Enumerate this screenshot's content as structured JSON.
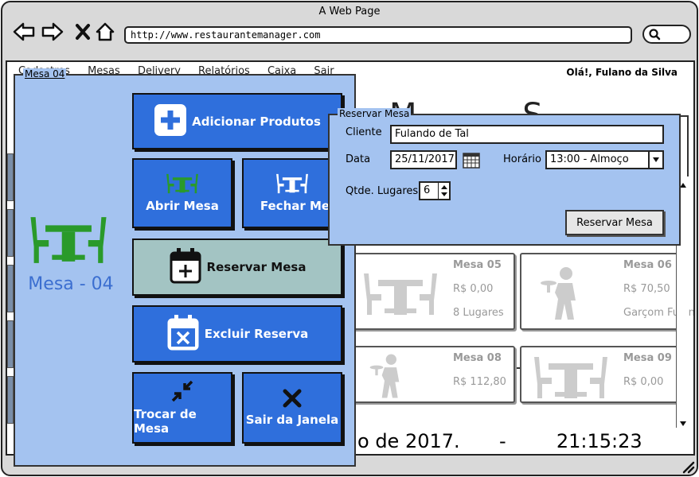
{
  "window": {
    "title": "A Web Page"
  },
  "browser": {
    "url": "http://www.restaurantemanager.com",
    "icons": [
      "back-arrow-icon",
      "forward-arrow-icon",
      "close-x-icon",
      "home-icon",
      "search-icon"
    ]
  },
  "app": {
    "menu": [
      "Cadastros",
      "Mesas",
      "Delivery",
      "Relatórios",
      "Caixa",
      "Sair"
    ],
    "greeting": "Olá!, Fulano da Silva",
    "bg_title": "M     S",
    "clock": {
      "date_fragment": "o de 2017.",
      "separator": "-",
      "time": "21:15:23"
    }
  },
  "tables": [
    {
      "name": "Mesa 05",
      "value": "R$ 0,00",
      "detail": "8 Lugares",
      "icon": "table-icon"
    },
    {
      "name": "Mesa 06",
      "value": "R$ 70,50",
      "detail": "Garçom Fulano",
      "icon": "waiter-icon"
    },
    {
      "name": "Mesa 08",
      "value": "R$ 112,80",
      "detail": "",
      "icon": "waiter-icon"
    },
    {
      "name": "Mesa 09",
      "value": "R$ 0,00",
      "detail": "",
      "icon": "table-icon"
    }
  ],
  "mesa_dialog": {
    "title": "Mesa 04",
    "table_label": "Mesa - 04",
    "buttons": {
      "add_products": "Adicionar Produtos",
      "open_table": "Abrir Mesa",
      "close_table": "Fechar Mesa",
      "reserve_table": "Reservar Mesa",
      "delete_reservation": "Excluir Reserva",
      "change_table": "Trocar de Mesa",
      "exit_window": "Sair da Janela"
    }
  },
  "reserva_dialog": {
    "title": "Reservar Mesa",
    "labels": {
      "client": "Cliente",
      "date": "Data",
      "time": "Horário",
      "seats": "Qtde. Lugares"
    },
    "values": {
      "client": "Fulando de Tal",
      "date": "25/11/2017",
      "time": "13:00 - Almoço",
      "seats": "6"
    },
    "submit": "Reservar Mesa"
  },
  "colors": {
    "dialog_bg": "#a4c3f0",
    "button_blue": "#2f6fdc",
    "button_muted": "#a3c4c3",
    "table_green": "#2a9a2a",
    "accent_text": "#3b6ed0"
  }
}
